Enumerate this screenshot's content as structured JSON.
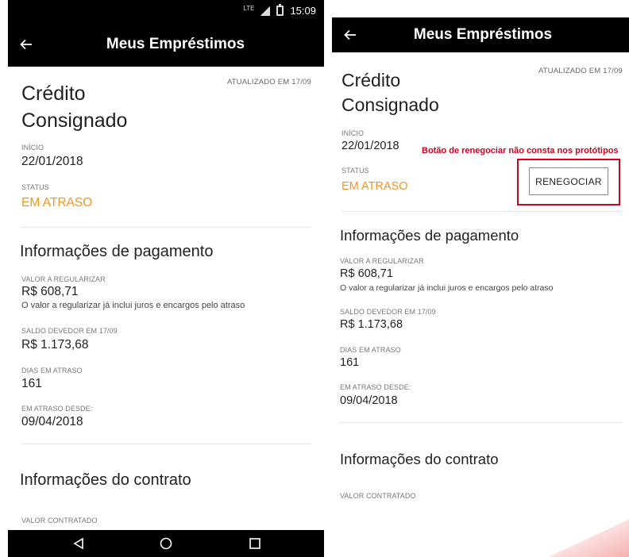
{
  "status_bar": {
    "network": "LTE",
    "time": "15:09"
  },
  "app_bar": {
    "title": "Meus Empréstimos"
  },
  "loan": {
    "updated": "ATUALIZADO EM 17/09",
    "title": "Crédito Consignado",
    "start_label": "INÍCIO",
    "start_value": "22/01/2018",
    "status_label": "STATUS",
    "status_value": "EM ATRASO"
  },
  "payment": {
    "section_title": "Informações de pagamento",
    "amount_label": "VALOR A REGULARIZAR",
    "amount_value": "R$ 608,71",
    "amount_note": "O valor a regularizar já inclui juros e encargos pelo atraso",
    "balance_label": "SALDO DEVEDOR EM  17/09",
    "balance_value": "R$ 1.173,68",
    "days_label": "DIAS EM ATRASO",
    "days_value": "161",
    "since_label": "EM ATRASO DESDE:",
    "since_value": "09/04/2018"
  },
  "contract": {
    "section_title": "Informações do contrato",
    "contracted_label": "VALOR CONTRATADO"
  },
  "renegotiate": {
    "button_label": "RENEGOCIAR",
    "annotation": "Botão de renegociar não consta nos protótipos"
  },
  "colors": {
    "status": "#f7941d",
    "annotation": "#d0021b",
    "bar": "#000000"
  },
  "icons": {
    "back": "arrow-left-icon",
    "nav_back": "triangle-back-icon",
    "nav_home": "circle-home-icon",
    "nav_recents": "square-recents-icon"
  }
}
